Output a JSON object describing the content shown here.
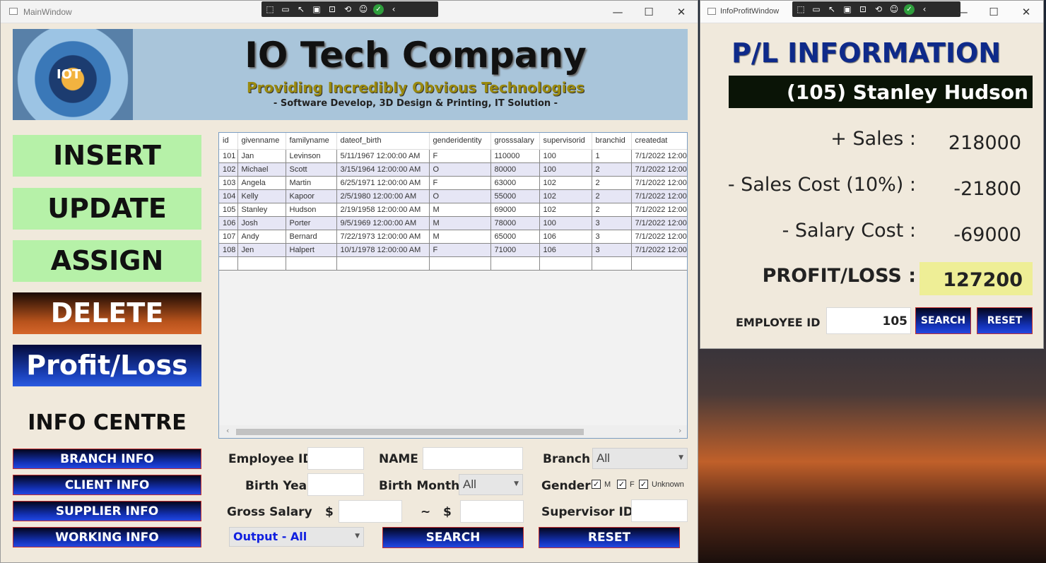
{
  "main_window": {
    "title": "MainWindow",
    "controls": {
      "minimize": "—",
      "maximize": "☐",
      "close": "✕"
    },
    "banner": {
      "logo_text": "IOT",
      "company_name": "IO Tech Company",
      "tagline": "Providing Incredibly Obvious Technologies",
      "subtag": "- Software Develop, 3D Design & Printing, IT Solution -"
    },
    "nav": {
      "insert": "INSERT",
      "update": "UPDATE",
      "assign": "ASSIGN",
      "delete": "DELETE",
      "profit_loss": "Profit/Loss"
    },
    "info_centre": {
      "title": "INFO CENTRE",
      "branch": "BRANCH INFO",
      "client": "CLIENT INFO",
      "supplier": "SUPPLIER INFO",
      "working": "WORKING INFO"
    },
    "grid": {
      "columns": [
        "id",
        "givenname",
        "familyname",
        "dateof_birth",
        "genderidentity",
        "grosssalary",
        "supervisorid",
        "branchid",
        "createdat"
      ],
      "rows": [
        [
          "101",
          "Jan",
          "Levinson",
          "5/11/1967 12:00:00 AM",
          "F",
          "110000",
          "100",
          "1",
          "7/1/2022 12:00"
        ],
        [
          "102",
          "Michael",
          "Scott",
          "3/15/1964 12:00:00 AM",
          "O",
          "80000",
          "100",
          "2",
          "7/1/2022 12:00"
        ],
        [
          "103",
          "Angela",
          "Martin",
          "6/25/1971 12:00:00 AM",
          "F",
          "63000",
          "102",
          "2",
          "7/1/2022 12:00"
        ],
        [
          "104",
          "Kelly",
          "Kapoor",
          "2/5/1980 12:00:00 AM",
          "O",
          "55000",
          "102",
          "2",
          "7/1/2022 12:00"
        ],
        [
          "105",
          "Stanley",
          "Hudson",
          "2/19/1958 12:00:00 AM",
          "M",
          "69000",
          "102",
          "2",
          "7/1/2022 12:00"
        ],
        [
          "106",
          "Josh",
          "Porter",
          "9/5/1969 12:00:00 AM",
          "M",
          "78000",
          "100",
          "3",
          "7/1/2022 12:00"
        ],
        [
          "107",
          "Andy",
          "Bernard",
          "7/22/1973 12:00:00 AM",
          "M",
          "65000",
          "106",
          "3",
          "7/1/2022 12:00"
        ],
        [
          "108",
          "Jen",
          "Halpert",
          "10/1/1978 12:00:00 AM",
          "F",
          "71000",
          "106",
          "3",
          "7/1/2022 12:00"
        ]
      ]
    },
    "form": {
      "employee_id_label": "Employee ID",
      "name_label": "NAME",
      "branch_label": "Branch",
      "branch_value": "All",
      "birth_year_label": "Birth Year",
      "birth_month_label": "Birth Month",
      "birth_month_value": "All",
      "gender_label": "Gender",
      "gender_m": "M",
      "gender_f": "F",
      "gender_unknown": "Unknown",
      "check_mark": "✓",
      "gross_salary_label": "Gross Salary",
      "dollar": "$",
      "tilde": "~",
      "supervisor_label": "Supervisor ID",
      "output_value": "Output - All",
      "search": "SEARCH",
      "reset": "RESET"
    }
  },
  "pl_window": {
    "title": "InfoProfitWindow",
    "controls": {
      "minimize": "—",
      "maximize": "☐",
      "close": "✕"
    },
    "heading": "P/L INFORMATION",
    "employee_banner": "(105) Stanley Hudson",
    "sales_label": "+ Sales :",
    "sales_value": "218000",
    "sales_cost_label": "- Sales Cost (10%) :",
    "sales_cost_value": "-21800",
    "salary_cost_label": "- Salary Cost :",
    "salary_cost_value": "-69000",
    "profit_label": "PROFIT/LOSS :",
    "profit_value": "127200",
    "employee_id_label": "EMPLOYEE ID",
    "employee_id_value": "105",
    "search": "SEARCH",
    "reset": "RESET"
  },
  "devtools": {
    "icons": [
      "select-element-icon",
      "video-icon",
      "cursor-icon",
      "frame-icon",
      "layout-icon",
      "hot-reload-icon",
      "accessibility-icon",
      "check-icon",
      "collapse-icon"
    ]
  },
  "colors": {
    "window_bg": "#f0e9dc",
    "banner_bg": "#a9c5da",
    "green_button": "#b6f1a8",
    "blue_button": "#1332b8",
    "red_button": "#b8531c",
    "profit_highlight": "#eeee96"
  }
}
